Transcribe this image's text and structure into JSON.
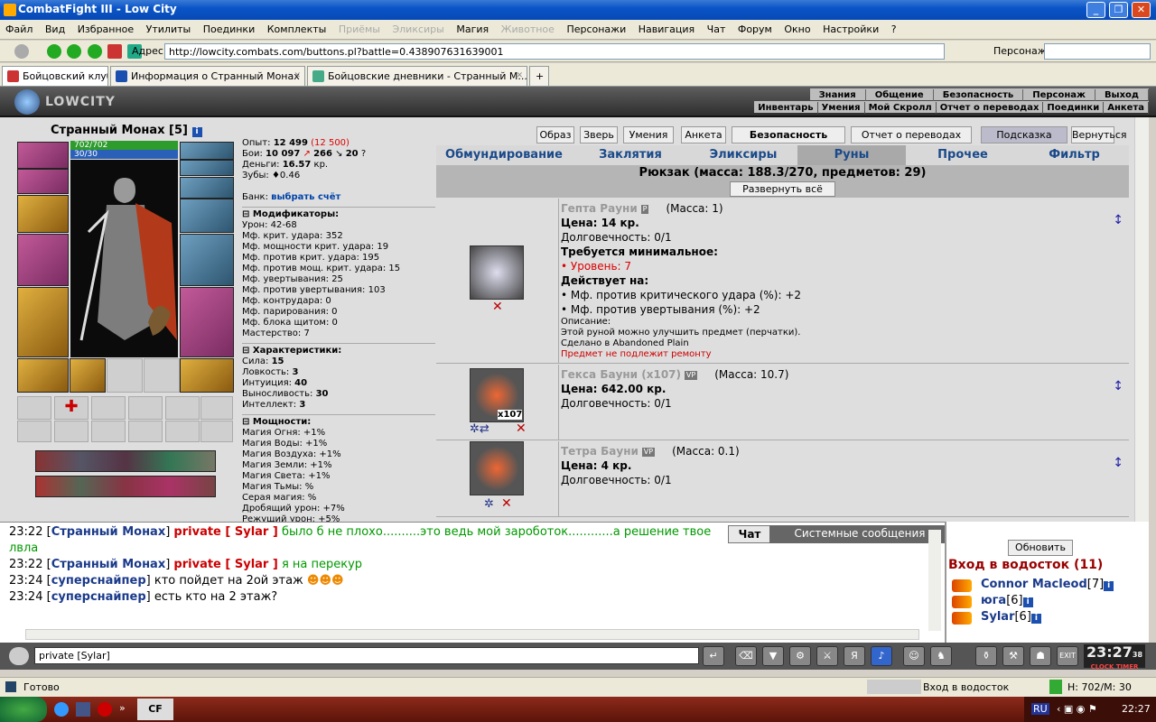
{
  "window": {
    "title": "CombatFight III - Low City"
  },
  "menu": [
    "Файл",
    "Вид",
    "Избранное",
    "Утилиты",
    "Поединки",
    "Комплекты",
    "Приёмы",
    "Эликсиры",
    "Магия",
    "Животное",
    "Персонажи",
    "Навигация",
    "Чат",
    "Форум",
    "Окно",
    "Настройки",
    "?"
  ],
  "menu_disabled": [
    "Приёмы",
    "Эликсиры",
    "Животное"
  ],
  "address": {
    "label": "Адрес:",
    "url": "http://lowcity.combats.com/buttons.pl?battle=0.438907631639001",
    "persona_label": "Персонаж:"
  },
  "tabs": [
    {
      "label": "Бойцовский клуб"
    },
    {
      "label": "Информация о Странный Монах"
    },
    {
      "label": "Бойцовские дневники - Странный М..."
    }
  ],
  "game_header": {
    "logo": "LOWCITY",
    "nav1": [
      "Знания",
      "Общение",
      "Безопасность",
      "Персонаж",
      "Выход"
    ],
    "nav2": [
      "Инвентарь",
      "Умения",
      "Мой Скролл",
      "Отчет о переводах",
      "Поединки",
      "Анкета"
    ]
  },
  "character": {
    "name": "Странный Монах",
    "level": "[5]",
    "hp": "702/702",
    "mp": "30/30"
  },
  "stats": {
    "exp_label": "Опыт:",
    "exp": "12 499",
    "exp_next": "(12 500)",
    "fights_label": "Бои:",
    "wins": "10 097",
    "losses": "266",
    "draws": "20",
    "money_label": "Деньги:",
    "money": "16.57",
    "money_unit": "кр.",
    "teeth_label": "Зубы:",
    "teeth": "0.46",
    "bank_label": "Банк:",
    "bank_link": "выбрать счёт"
  },
  "modifiers": {
    "title": "Модификаторы:",
    "lines": [
      "Урон: 42-68",
      "Мф. крит. удара: 352",
      "Мф. мощности крит. удара: 19",
      "Мф. против крит. удара: 195",
      "Мф. против мощ. крит. удара: 15",
      "Мф. увертывания: 25",
      "Мф. против увертывания: 103",
      "Мф. контрудара: 0",
      "Мф. парирования: 0",
      "Мф. блока щитом: 0",
      "Мастерство: 7"
    ]
  },
  "characteristics": {
    "title": "Характеристики:",
    "lines": [
      {
        "k": "Сила:",
        "v": "15"
      },
      {
        "k": "Ловкость:",
        "v": "3"
      },
      {
        "k": "Интуиция:",
        "v": "40"
      },
      {
        "k": "Выносливость:",
        "v": "30"
      },
      {
        "k": "Интеллект:",
        "v": "3"
      }
    ]
  },
  "powers": {
    "title": "Мощности:",
    "lines": [
      "Магия Огня: +1%",
      "Магия Воды: +1%",
      "Магия Воздуха: +1%",
      "Магия Земли: +1%",
      "Магия Света: +1%",
      "Магия Тьмы: %",
      "Серая магия: %",
      "Дробящий урон: +7%",
      "Режущий урон: +5%"
    ]
  },
  "top_buttons": [
    "Образ",
    "Зверь",
    "Умения",
    "Анкета",
    "Безопасность",
    "Отчет о переводах",
    "Подсказка",
    "Вернуться"
  ],
  "inventory_tabs": [
    "Обмундирование",
    "Заклятия",
    "Эликсиры",
    "Руны",
    "Прочее",
    "Фильтр"
  ],
  "bag": {
    "title": "Рюкзак (масса: 188.3/270, предметов: 29)",
    "expand": "Развернуть всё"
  },
  "items": [
    {
      "name": "Гепта Рауни",
      "tag": "P",
      "mass": "(Масса: 1)",
      "price": "Цена: 14 кр.",
      "durability": "Долговечность: 0/1",
      "req_title": "Требуется минимальное:",
      "req": "• Уровень: 7",
      "acts_title": "Действует на:",
      "acts": [
        "• Мф. против критического удара (%): +2",
        "• Мф. против увертывания (%): +2"
      ],
      "desc_title": "Описание:",
      "desc": [
        "Этой руной можно улучшить предмет (перчатки).",
        "Сделано в Abandoned Plain"
      ],
      "note": "Предмет не подлежит ремонту"
    },
    {
      "name": "Гекса Бауни (x107)",
      "tag": "VP",
      "mass": "(Масса: 10.7)",
      "price": "Цена: 642.00 кр.",
      "durability": "Долговечность: 0/1",
      "count": "x107"
    },
    {
      "name": "Тетра Бауни",
      "tag": "VP",
      "mass": "(Масса: 0.1)",
      "price": "Цена: 4 кр.",
      "durability": "Долговечность: 0/1"
    }
  ],
  "chat": {
    "lines": [
      {
        "time": "23:22",
        "nick": "Странный Монах",
        "priv": "private [ Sylar ]",
        "text": "было б не плохо..........это ведь мой зароботок............а решение твое",
        "cont": "лвла",
        "green": true
      },
      {
        "time": "23:22",
        "nick": "Странный Монах",
        "priv": "private [ Sylar ]",
        "text": "я на перекур",
        "green": true
      },
      {
        "time": "23:24",
        "nick": "суперснайпер",
        "priv": "",
        "text": "кто пойдет на 2ой этаж",
        "green": false
      },
      {
        "time": "23:24",
        "nick": "суперснайпер",
        "priv": "",
        "text": "есть кто на 2 этаж?",
        "green": false
      }
    ],
    "tab_chat": "Чат",
    "tab_system": "Системные сообщения",
    "input": "private [Sylar]"
  },
  "location": {
    "refresh": "Обновить",
    "title": "Вход в водосток (11)",
    "players": [
      {
        "name": "Connor Macleod",
        "lvl": "[7]"
      },
      {
        "name": "юга",
        "lvl": "[6]"
      },
      {
        "name": "Sylar",
        "lvl": "[6]"
      }
    ]
  },
  "clock": {
    "time": "23:27",
    "sec": "38",
    "labels": "CLOCK TIMER"
  },
  "status": {
    "text": "Готово",
    "location": "Вход в водосток",
    "hpmp": "H: 702/M: 30"
  },
  "taskbar": {
    "app": "CF",
    "lang": "RU",
    "time": "22:27"
  },
  "colors": {
    "accent": "#1a4a8a",
    "hp": "#2d9c2d",
    "mp": "#2b60b8",
    "danger": "#cc0000",
    "private_green": "#009900"
  }
}
